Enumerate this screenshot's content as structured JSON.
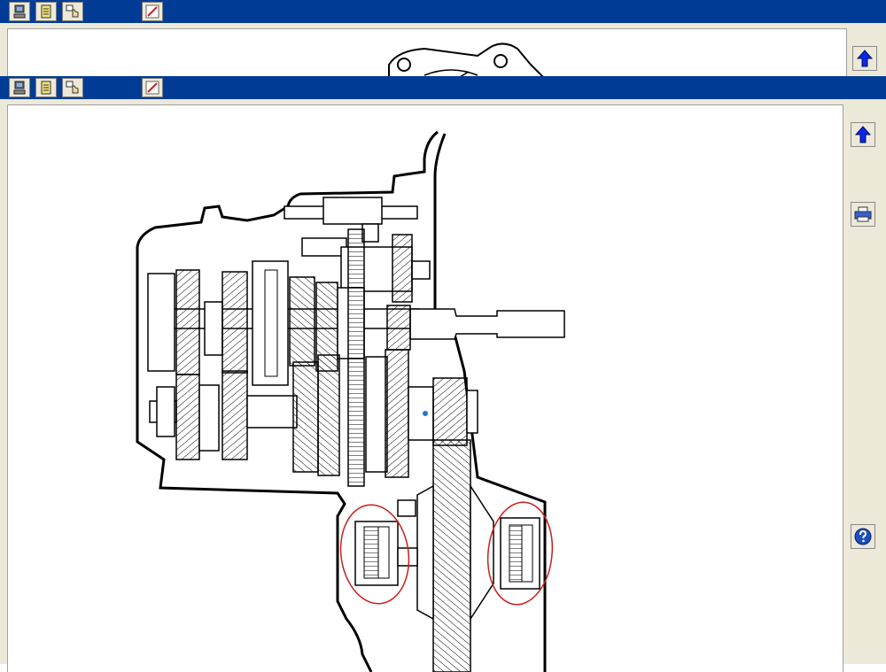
{
  "window_back": {
    "toolbar_icons": [
      "computer-icon",
      "document-icon",
      "hand-pointer-icon",
      "edit-pen-icon"
    ],
    "side_icons": [
      "arrow-up-icon"
    ]
  },
  "window_front": {
    "toolbar_icons": [
      "computer-icon",
      "document-icon",
      "hand-pointer-icon",
      "edit-pen-icon"
    ],
    "side_icons": [
      "arrow-up-icon",
      "printer-icon",
      "help-icon"
    ]
  },
  "colors": {
    "titlebar": "#003c96",
    "panel": "#ece9d8",
    "arrow": "#0a28e6",
    "annotation": "#c81e1e"
  }
}
